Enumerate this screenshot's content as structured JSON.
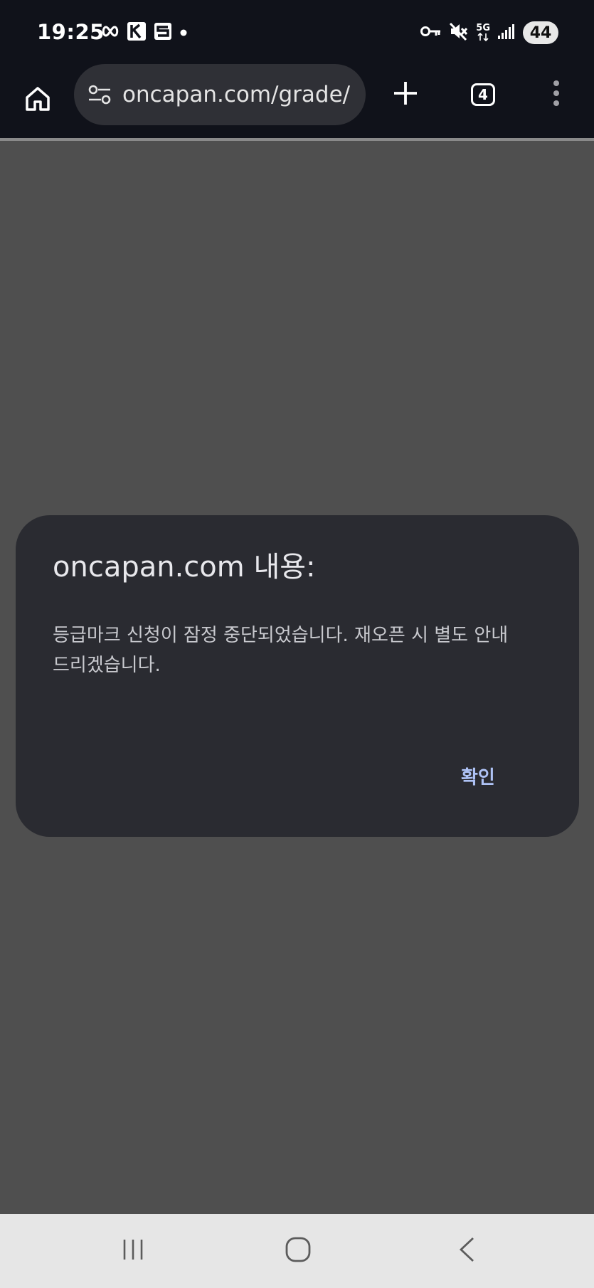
{
  "status_bar": {
    "time": "19:25",
    "battery": "44",
    "network": "5G"
  },
  "browser": {
    "url": "oncapan.com/grade/",
    "tab_count": "4"
  },
  "dialog": {
    "title": "oncapan.com 내용:",
    "message": "등급마크 신청이 잠정 중단되었습니다. 재오픈 시 별도 안내드리겠습니다.",
    "confirm_label": "확인"
  },
  "colors": {
    "toolbar_bg": "#10121a",
    "page_bg": "#4f4f4f",
    "dialog_bg": "#2a2b31",
    "accent": "#aec2f5"
  }
}
